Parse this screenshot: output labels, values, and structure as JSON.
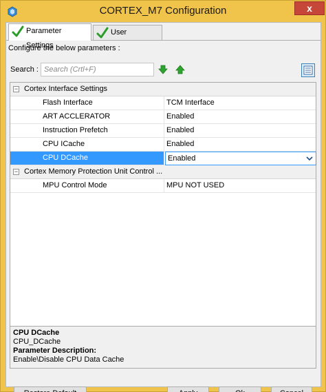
{
  "window": {
    "title": "CORTEX_M7 Configuration",
    "close_label": "x"
  },
  "tabs": [
    {
      "label": "Parameter Settings",
      "active": true
    },
    {
      "label": "User Constants",
      "active": false
    }
  ],
  "instructions": "Configure the below parameters :",
  "search": {
    "label": "Search :",
    "placeholder": "Search (Crtl+F)",
    "value": ""
  },
  "grid": {
    "categories": [
      {
        "label": "Cortex Interface Settings",
        "expanded": true,
        "rows": [
          {
            "name": "Flash Interface",
            "value": "TCM Interface"
          },
          {
            "name": "ART ACCLERATOR",
            "value": "Enabled"
          },
          {
            "name": "Instruction Prefetch",
            "value": "Enabled"
          },
          {
            "name": "CPU ICache",
            "value": "Enabled"
          },
          {
            "name": "CPU DCache",
            "value": "Enabled",
            "selected": true
          }
        ]
      },
      {
        "label": "Cortex Memory Protection Unit Control ...",
        "expanded": true,
        "rows": [
          {
            "name": "MPU Control Mode",
            "value": "MPU NOT USED"
          }
        ]
      }
    ]
  },
  "info": {
    "title": "CPU DCache",
    "id": "CPU_DCache",
    "desc_label": "Parameter Description:",
    "description": "Enable\\Disable CPU Data Cache"
  },
  "buttons": {
    "restore": "Restore Default",
    "apply": "Apply",
    "ok": "Ok",
    "cancel": "Cancel"
  },
  "colors": {
    "title_bar": "#f0c34a",
    "selection": "#3399ff",
    "check": "#2a9d2a",
    "arrow": "#2fa32f",
    "close": "#c7463a"
  }
}
